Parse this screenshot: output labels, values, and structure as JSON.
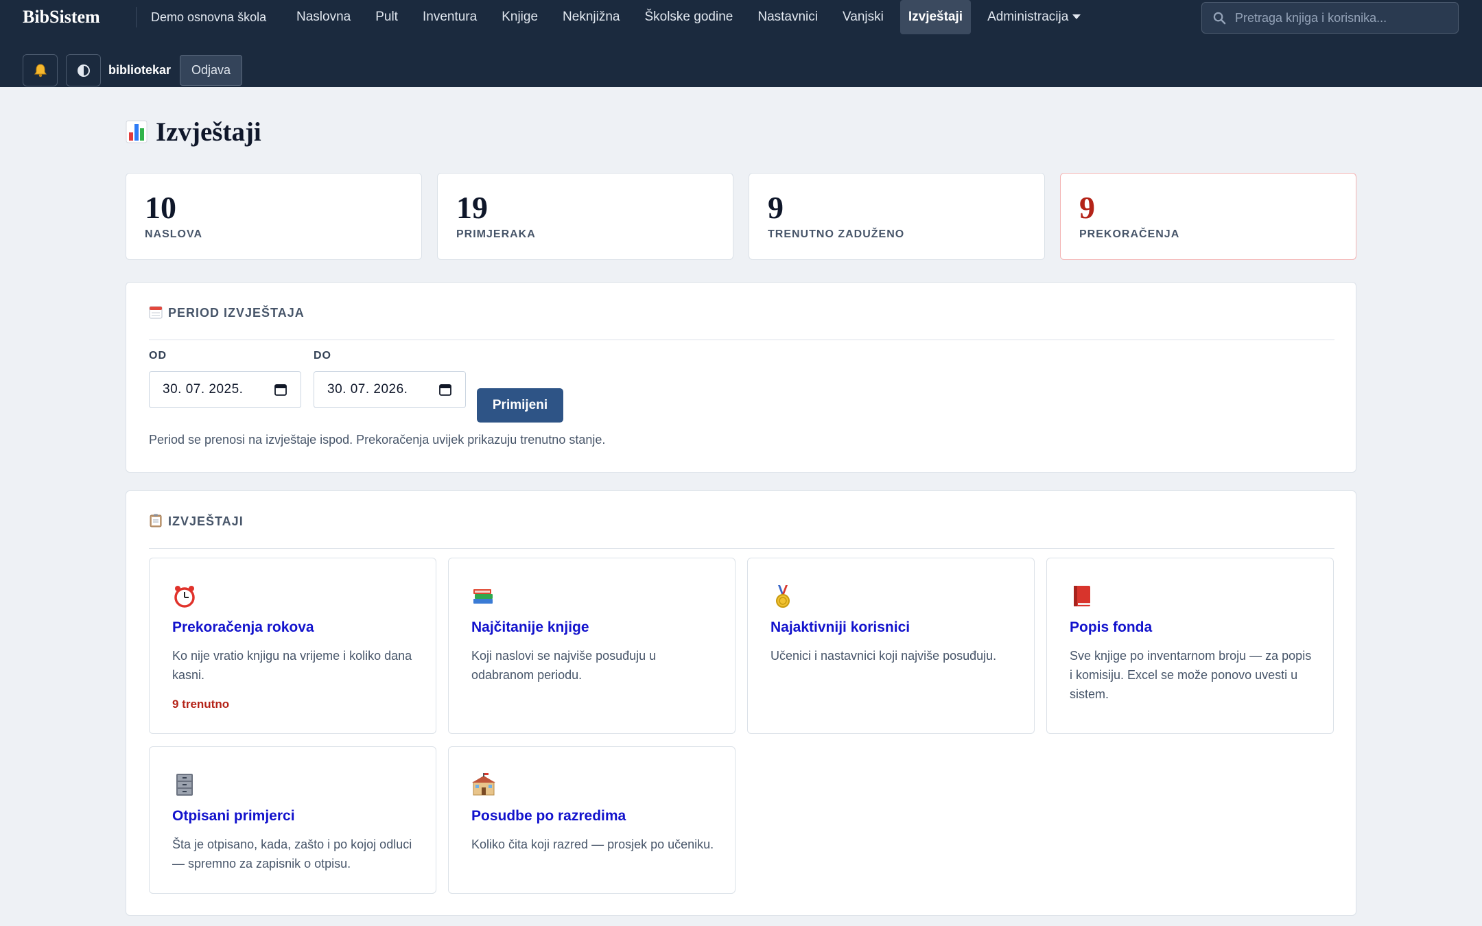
{
  "header": {
    "brand": "BibSistem",
    "school": "Demo osnovna škola",
    "nav": [
      {
        "label": "Naslovna"
      },
      {
        "label": "Pult"
      },
      {
        "label": "Inventura"
      },
      {
        "label": "Knjige"
      },
      {
        "label": "Neknjižna"
      },
      {
        "label": "Školske godine"
      },
      {
        "label": "Nastavnici"
      },
      {
        "label": "Vanjski"
      },
      {
        "label": "Izvještaji",
        "active": true
      },
      {
        "label": "Administracija",
        "has_dropdown": true
      }
    ],
    "search_placeholder": "Pretraga knjiga i korisnika...",
    "notifications_icon": "bell-icon",
    "theme_icon": "contrast-icon",
    "user": "bibliotekar",
    "logout_label": "Odjava"
  },
  "page": {
    "title": "Izvještaji",
    "title_icon": "bar-chart-icon"
  },
  "stats": [
    {
      "value": "10",
      "label": "NASLOVA"
    },
    {
      "value": "19",
      "label": "PRIMJERAKA"
    },
    {
      "value": "9",
      "label": "TRENUTNO ZADUŽENO"
    },
    {
      "value": "9",
      "label": "PREKORAČENJA",
      "status": "danger"
    }
  ],
  "period": {
    "title": "PERIOD IZVJEŠTAJA",
    "icon": "calendar-icon",
    "from_label": "OD",
    "from_value": "30. 07. 2025.",
    "to_label": "DO",
    "to_value": "30. 07. 2026.",
    "apply_label": "Primijeni",
    "note": "Period se prenosi na izvještaje ispod. Prekoračenja uvijek prikazuju trenutno stanje."
  },
  "reports": {
    "title": "IZVJEŠTAJI",
    "icon": "clipboard-icon",
    "items": [
      {
        "icon": "alarm-clock-icon",
        "title": "Prekoračenja rokova",
        "desc": "Ko nije vratio knjigu na vrijeme i koliko dana kasni.",
        "badge": "9 trenutno"
      },
      {
        "icon": "books-icon",
        "title": "Najčitanije knjige",
        "desc": "Koji naslovi se najviše posuđuju u odabranom periodu."
      },
      {
        "icon": "medal-icon",
        "title": "Najaktivniji korisnici",
        "desc": "Učenici i nastavnici koji najviše posuđuju."
      },
      {
        "icon": "red-book-icon",
        "title": "Popis fonda",
        "desc": "Sve knjige po inventarnom broju — za popis i komisiju. Excel se može ponovo uvesti u sistem."
      },
      {
        "icon": "file-cabinet-icon",
        "title": "Otpisani primjerci",
        "desc": "Šta je otpisano, kada, zašto i po kojoj odluci — spremno za zapisnik o otpisu."
      },
      {
        "icon": "school-icon",
        "title": "Posudbe po razredima",
        "desc": "Koliko čita koji razred — prosjek po učeniku."
      }
    ]
  },
  "colors": {
    "topbar": "#1b2a3e",
    "link": "#1212cc",
    "danger": "#b42318",
    "primary_button": "#2e5486",
    "page_bg": "#eef1f5"
  }
}
